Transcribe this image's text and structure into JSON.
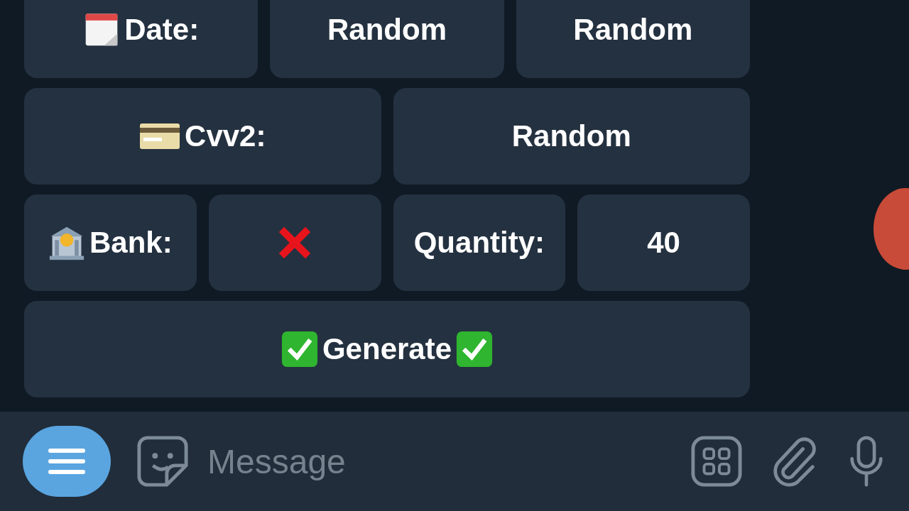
{
  "keyboard": {
    "rows": [
      {
        "buttons": [
          {
            "kind": "calendar",
            "label": "Date:"
          },
          {
            "kind": "text",
            "label": "Random"
          },
          {
            "kind": "text",
            "label": "Random"
          }
        ]
      },
      {
        "buttons": [
          {
            "kind": "card",
            "label": "Cvv2:"
          },
          {
            "kind": "text",
            "label": "Random"
          }
        ]
      },
      {
        "buttons": [
          {
            "kind": "bank",
            "label": "Bank:"
          },
          {
            "kind": "cross"
          },
          {
            "kind": "text",
            "label": "Quantity:"
          },
          {
            "kind": "text",
            "label": "40"
          }
        ]
      },
      {
        "buttons": [
          {
            "kind": "check",
            "label": "Generate"
          }
        ]
      }
    ]
  },
  "composer": {
    "placeholder": "Message"
  }
}
